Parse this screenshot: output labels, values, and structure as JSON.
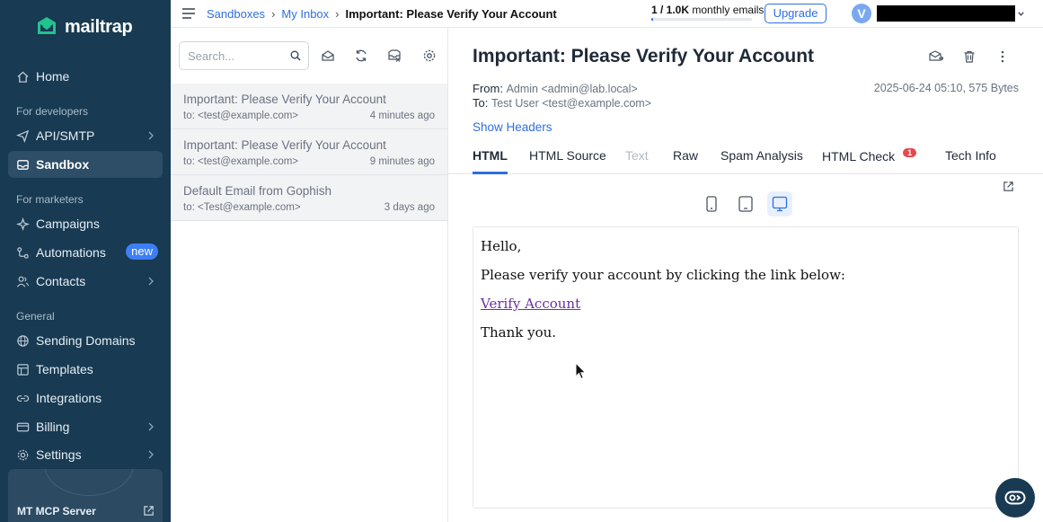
{
  "brand": {
    "name": "mailtrap"
  },
  "sidebar": {
    "home": "Home",
    "section_developers": "For developers",
    "api_smtp": "API/SMTP",
    "sandbox": "Sandbox",
    "section_marketers": "For marketers",
    "campaigns": "Campaigns",
    "automations": "Automations",
    "new_badge": "new",
    "contacts": "Contacts",
    "section_general": "General",
    "sending_domains": "Sending Domains",
    "templates": "Templates",
    "integrations": "Integrations",
    "billing": "Billing",
    "settings": "Settings",
    "mcp_server": "MT MCP Server"
  },
  "topbar": {
    "breadcrumbs": [
      "Sandboxes",
      "My Inbox",
      "Important: Please Verify Your Account"
    ],
    "separator": "›",
    "quota_used": "1 / 1.0K",
    "quota_label": "monthly emails",
    "quota_fraction": 0.001,
    "upgrade": "Upgrade",
    "avatar_initial": "V"
  },
  "list": {
    "search_placeholder": "Search...",
    "messages": [
      {
        "subject": "Important: Please Verify Your Account",
        "to": "to: <test@example.com>",
        "time": "4 minutes ago"
      },
      {
        "subject": "Important: Please Verify Your Account",
        "to": "to: <test@example.com>",
        "time": "9 minutes ago"
      },
      {
        "subject": "Default Email from Gophish",
        "to": "to: <Test@example.com>",
        "time": "3 days ago"
      }
    ]
  },
  "detail": {
    "subject": "Important: Please Verify Your Account",
    "from_label": "From:",
    "from_value": "Admin <admin@lab.local>",
    "to_label": "To:",
    "to_value": "Test User <test@example.com>",
    "date_size": "2025-06-24 05:10, 575 Bytes",
    "show_headers": "Show Headers",
    "tabs": [
      "HTML",
      "HTML Source",
      "Text",
      "Raw",
      "Spam Analysis",
      "HTML Check",
      "Tech Info"
    ],
    "html_check_count": "1",
    "body": {
      "greeting": "Hello,",
      "line1": "Please verify your account by clicking the link below:",
      "link": "Verify Account",
      "closing": "Thank you."
    }
  },
  "colors": {
    "sidebar": "#183a52",
    "accent": "#2f6fe0",
    "badge": "#e5484d"
  }
}
